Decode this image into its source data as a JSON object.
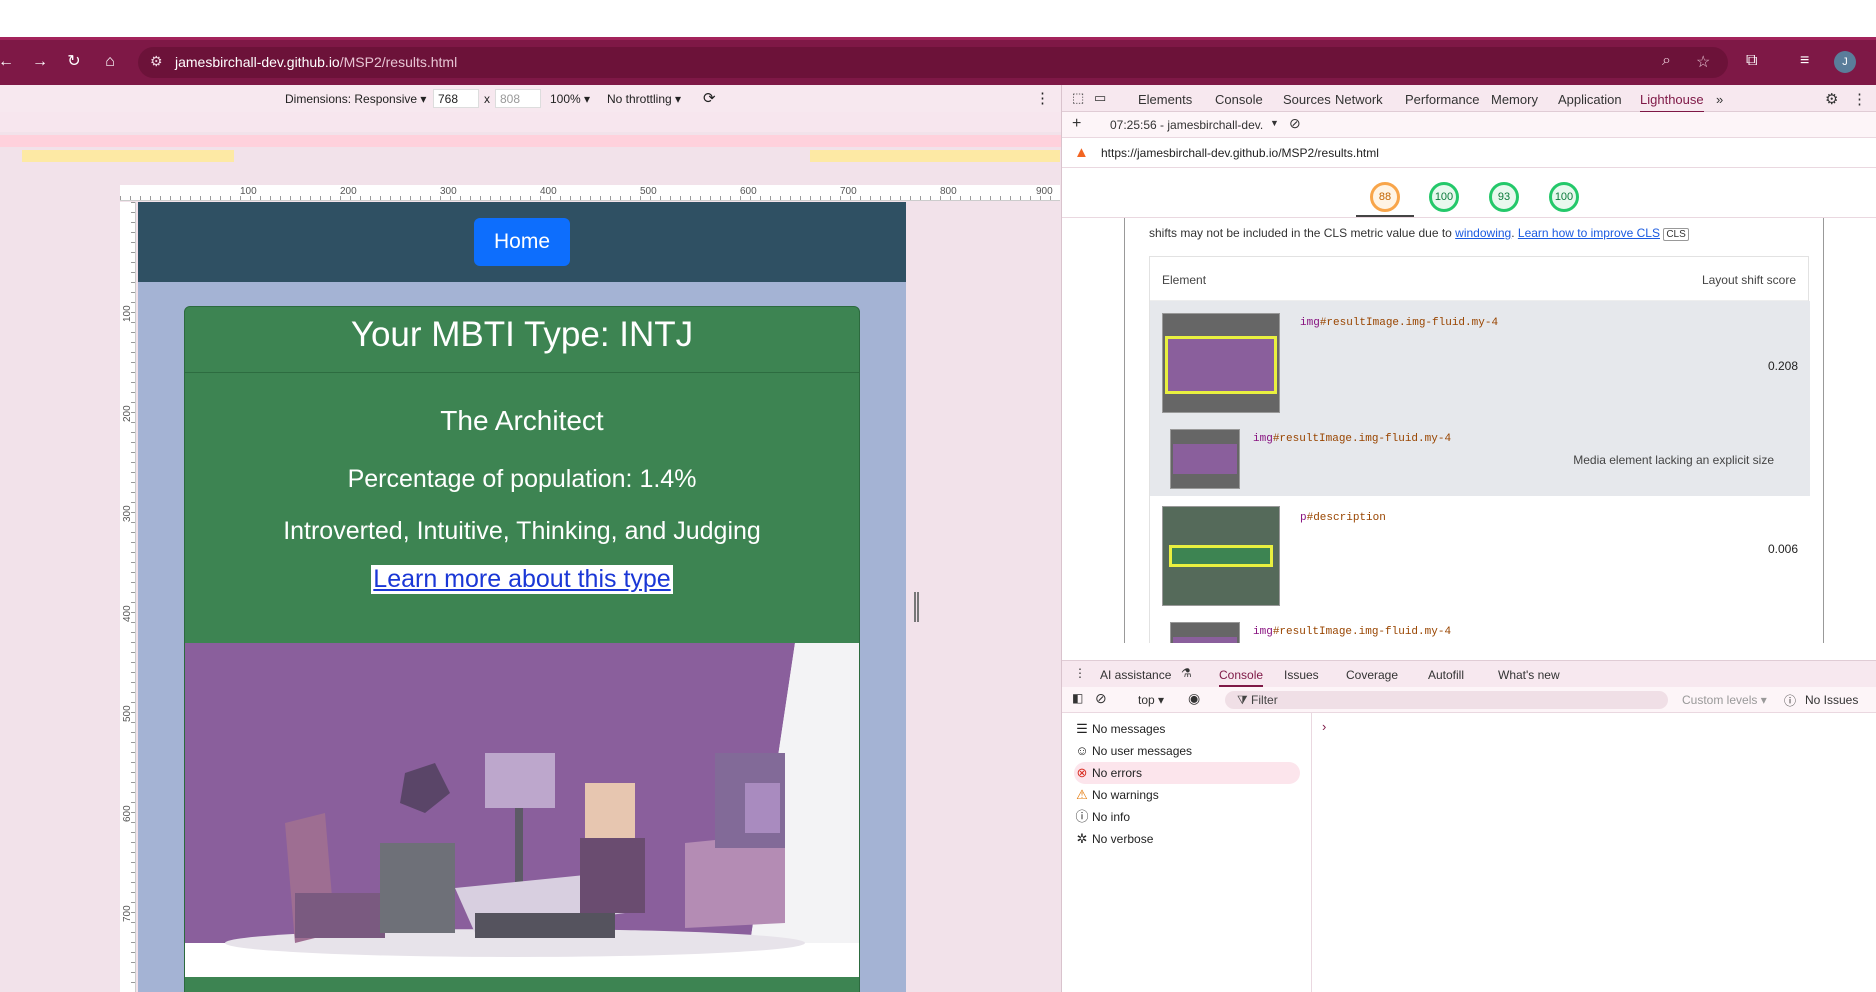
{
  "browser": {
    "url_host": "jamesbirchall-dev.github.io",
    "url_path": "/MSP2/results.html",
    "avatar_letter": "J"
  },
  "device_toolbar": {
    "dimensions_label": "Dimensions: Responsive ▾",
    "width": "768",
    "x_label": "x",
    "height": "808",
    "zoom": "100% ▾",
    "throttling": "No throttling ▾"
  },
  "ruler": {
    "h_ticks": [
      "100",
      "200",
      "300",
      "400",
      "500",
      "600",
      "700",
      "800",
      "900"
    ],
    "v_ticks": [
      "100",
      "200",
      "300",
      "400",
      "500",
      "600",
      "700"
    ]
  },
  "page": {
    "home_button": "Home",
    "heading": "Your MBTI Type: INTJ",
    "type_name": "The Architect",
    "population": "Percentage of population: 1.4%",
    "traits": "Introverted, Intuitive, Thinking, and Judging",
    "learn_more": "Learn more about this type"
  },
  "devtools": {
    "tabs": [
      "Elements",
      "Console",
      "Sources",
      "Network",
      "Performance",
      "Memory",
      "Application",
      "Lighthouse"
    ],
    "active_tab": "Lighthouse",
    "report_selector": "07:25:56 - jamesbirchall-dev.",
    "report_url": "https://jamesbirchall-dev.github.io/MSP2/results.html",
    "scores": [
      "88",
      "100",
      "93",
      "100"
    ],
    "cls_note_prefix": "shifts may not be included in the CLS metric value due to ",
    "cls_link1": "windowing",
    "cls_link2": "Learn how to improve CLS",
    "cls_tag": "CLS",
    "table_header_element": "Element",
    "table_header_score": "Layout shift score",
    "rows": [
      {
        "tag": "img",
        "rest": "#resultImage.img-fluid.my-4",
        "score": "0.208"
      },
      {
        "tag": "img",
        "rest": "#resultImage.img-fluid.my-4",
        "note": "Media element lacking an explicit size"
      },
      {
        "tag": "p",
        "rest": "#description",
        "score": "0.006"
      },
      {
        "tag": "img",
        "rest": "#resultImage.img-fluid.my-4"
      }
    ]
  },
  "drawer": {
    "tabs": [
      "AI assistance",
      "Console",
      "Issues",
      "Coverage",
      "Autofill",
      "What's new"
    ],
    "active_tab": "Console",
    "context": "top ▾",
    "filter_placeholder": "Filter",
    "levels": "Custom levels ▾",
    "issues": "No Issues",
    "sidebar": [
      {
        "icon": "list-icon",
        "label": "No messages"
      },
      {
        "icon": "user-icon",
        "label": "No user messages"
      },
      {
        "icon": "error-icon",
        "label": "No errors"
      },
      {
        "icon": "warning-icon",
        "label": "No warnings"
      },
      {
        "icon": "info-icon",
        "label": "No info"
      },
      {
        "icon": "bug-icon",
        "label": "No verbose"
      }
    ]
  },
  "colors": {
    "browser_frame": "#7e1846",
    "site_nav": "#2f5063",
    "card_green": "#3d8452",
    "home_button": "#0d6efd",
    "viewport_bg": "#a4b3d4"
  }
}
